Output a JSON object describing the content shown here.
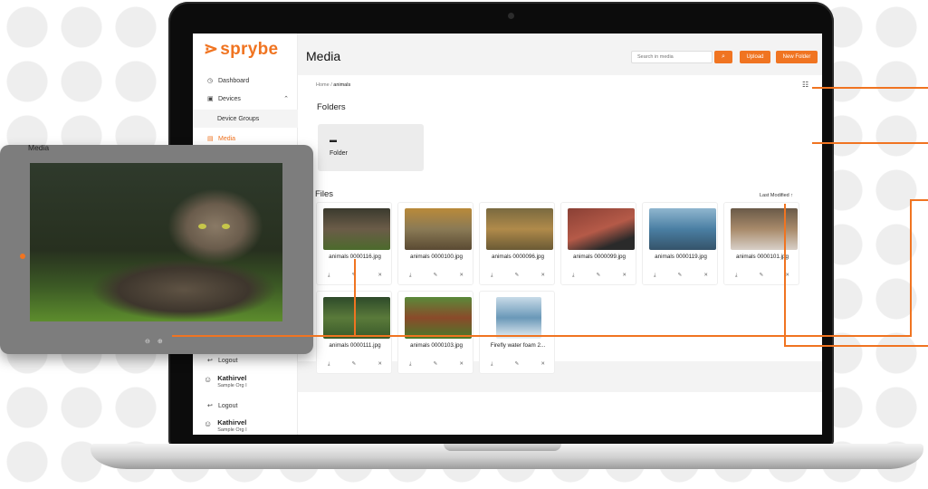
{
  "brand": {
    "name": "sprybe",
    "accent": "#f07421"
  },
  "sidebar": {
    "items": [
      {
        "label": "Dashboard",
        "icon": "dashboard-icon"
      },
      {
        "label": "Devices",
        "icon": "devices-icon"
      },
      {
        "label": "Device Groups"
      },
      {
        "label": "Media",
        "icon": "media-icon",
        "active": true
      },
      {
        "label": "Logout",
        "icon": "logout-icon"
      },
      {
        "label": "Logout",
        "icon": "logout-icon"
      }
    ],
    "users": [
      {
        "name": "Kathirvel",
        "org": "Sample Org I"
      },
      {
        "name": "Kathirvel",
        "org": "Sample Org I"
      }
    ]
  },
  "header": {
    "title": "Media",
    "search_placeholder": "Search in media",
    "search_icon": "search-icon",
    "upload_label": "Upload",
    "new_folder_label": "New Folder"
  },
  "breadcrumb": {
    "home": "Home",
    "sep": "/",
    "current": "animals"
  },
  "folders": {
    "title": "Folders",
    "items": [
      {
        "label": "Folder",
        "icon": "folder-icon"
      }
    ]
  },
  "files": {
    "title": "Files",
    "sort_label": "Last Modified",
    "items": [
      {
        "name": "animals 0000116.jpg"
      },
      {
        "name": "animals 0000100.jpg"
      },
      {
        "name": "animals 0000096.jpg"
      },
      {
        "name": "animals 0000099.jpg"
      },
      {
        "name": "animals 0000119.jpg"
      },
      {
        "name": "animals 0000101.jpg"
      },
      {
        "name": "animals 0000111.jpg"
      },
      {
        "name": "animals 0000103.jpg"
      },
      {
        "name": "Firefly water foam 2..."
      }
    ],
    "action_icons": [
      "download-icon",
      "edit-icon",
      "delete-icon"
    ]
  },
  "preview": {
    "title": "Media",
    "zoom_out_icon": "zoom-out-icon",
    "zoom_in_icon": "zoom-in-icon"
  }
}
